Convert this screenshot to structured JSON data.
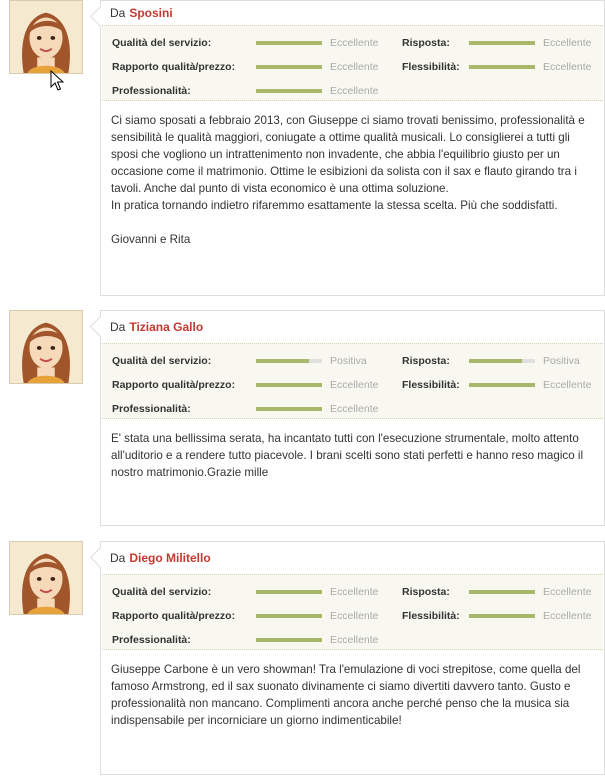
{
  "from_prefix": "Da",
  "reviews": [
    {
      "author": "Sposini",
      "ratings": [
        {
          "label": "Qualità del servizio:",
          "value": "Eccellente",
          "level": 1.0
        },
        {
          "label": "Risposta:",
          "value": "Eccellente",
          "level": 1.0
        },
        {
          "label": "Rapporto qualità/prezzo:",
          "value": "Eccellente",
          "level": 1.0
        },
        {
          "label": "Flessibilità:",
          "value": "Eccellente",
          "level": 1.0
        },
        {
          "label": "Professionalità:",
          "value": "Eccellente",
          "level": 1.0
        }
      ],
      "text": "Ci siamo sposati a febbraio 2013, con Giuseppe ci siamo trovati benissimo, professionalità e sensibilità le qualità maggiori, coniugate a ottime qualità musicali. Lo consiglierei a tutti gli sposi che vogliono un intrattenimento non invadente, che abbia l'equilibrio giusto per un occasione come il matrimonio. Ottime le esibizioni da solista con il sax e flauto girando tra i tavoli. Anche dal punto di vista economico è una ottima soluzione.\nIn pratica tornando indietro rifaremmo esattamente la stessa scelta. Più che soddisfatti.\n\nGiovanni e Rita"
    },
    {
      "author": "Tiziana Gallo",
      "ratings": [
        {
          "label": "Qualità del servizio:",
          "value": "Positiva",
          "level": 0.8
        },
        {
          "label": "Risposta:",
          "value": "Positiva",
          "level": 0.8
        },
        {
          "label": "Rapporto qualità/prezzo:",
          "value": "Eccellente",
          "level": 1.0
        },
        {
          "label": "Flessibilità:",
          "value": "Eccellente",
          "level": 1.0
        },
        {
          "label": "Professionalità:",
          "value": "Eccellente",
          "level": 1.0
        }
      ],
      "text": "E' stata una bellissima serata, ha incantato tutti con l'esecuzione strumentale, molto attento all'uditorio e a rendere tutto piacevole. I brani scelti sono stati perfetti e hanno reso magico il nostro matrimonio.Grazie mille"
    },
    {
      "author": "Diego Militello",
      "ratings": [
        {
          "label": "Qualità del servizio:",
          "value": "Eccellente",
          "level": 1.0
        },
        {
          "label": "Risposta:",
          "value": "Eccellente",
          "level": 1.0
        },
        {
          "label": "Rapporto qualità/prezzo:",
          "value": "Eccellente",
          "level": 1.0
        },
        {
          "label": "Flessibilità:",
          "value": "Eccellente",
          "level": 1.0
        },
        {
          "label": "Professionalità:",
          "value": "Eccellente",
          "level": 1.0
        }
      ],
      "text": "Giuseppe Carbone è un vero showman! Tra l'emulazione di voci strepitose, come quella del famoso Armstrong, ed il sax suonato divinamente ci siamo divertiti davvero tanto. Gusto e professionalità non mancano. Complimenti ancora anche perché penso che la musica sia indispensabile per incorniciare un giorno indimenticabile!"
    }
  ],
  "colors": {
    "author": "#c4392f",
    "bar_fill": "#a8b86a",
    "bar_track": "#e0e0e0",
    "rating_bg": "#f8f8f1"
  },
  "icons": {
    "avatar": "woman-avatar-icon",
    "cursor": "mouse-pointer-icon"
  }
}
